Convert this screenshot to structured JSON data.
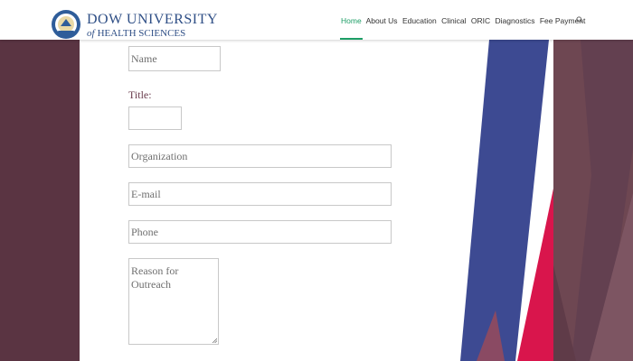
{
  "header": {
    "logo": {
      "line1": "DOW UNIVERSITY",
      "line2_prefix": "of",
      "line2": "HEALTH SCIENCES"
    },
    "nav": [
      "Home",
      "About Us",
      "Education",
      "Clinical",
      "ORIC",
      "Diagnostics",
      "Fee Payment"
    ],
    "active_nav": "Home",
    "search_icon": "search-icon"
  },
  "form": {
    "name_placeholder": "Name",
    "title_label": "Title:",
    "title_value": "",
    "organization_placeholder": "Organization",
    "email_placeholder": "E-mail",
    "phone_placeholder": "Phone",
    "reason_placeholder": "Reason for Outreach"
  },
  "colors": {
    "background_maroon": "#5a3442",
    "accent_green": "#1d9e66",
    "deco_blue": "#3d4a92",
    "deco_red": "#d9154c",
    "logo_blue": "#2f4f86"
  }
}
